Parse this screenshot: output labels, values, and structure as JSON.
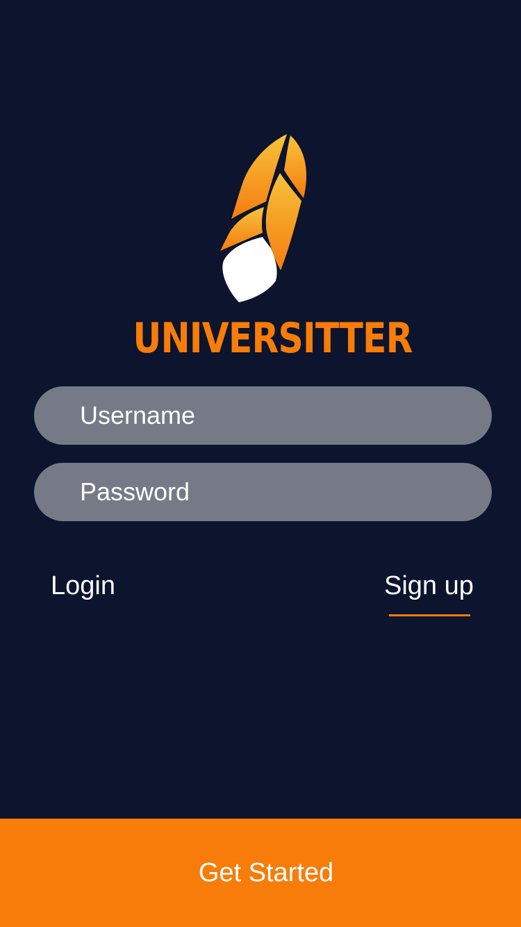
{
  "app": {
    "name": "UNIVERSITTER",
    "logo_icon": "flame-feather-icon"
  },
  "colors": {
    "background": "#0c142e",
    "accent": "#f77c09",
    "field_background": "#767a86",
    "text": "#ffffff"
  },
  "form": {
    "username_placeholder": "Username",
    "username_value": "",
    "password_placeholder": "Password",
    "password_value": ""
  },
  "tabs": {
    "login_label": "Login",
    "signup_label": "Sign up",
    "active": "signup"
  },
  "cta": {
    "label": "Get Started"
  }
}
